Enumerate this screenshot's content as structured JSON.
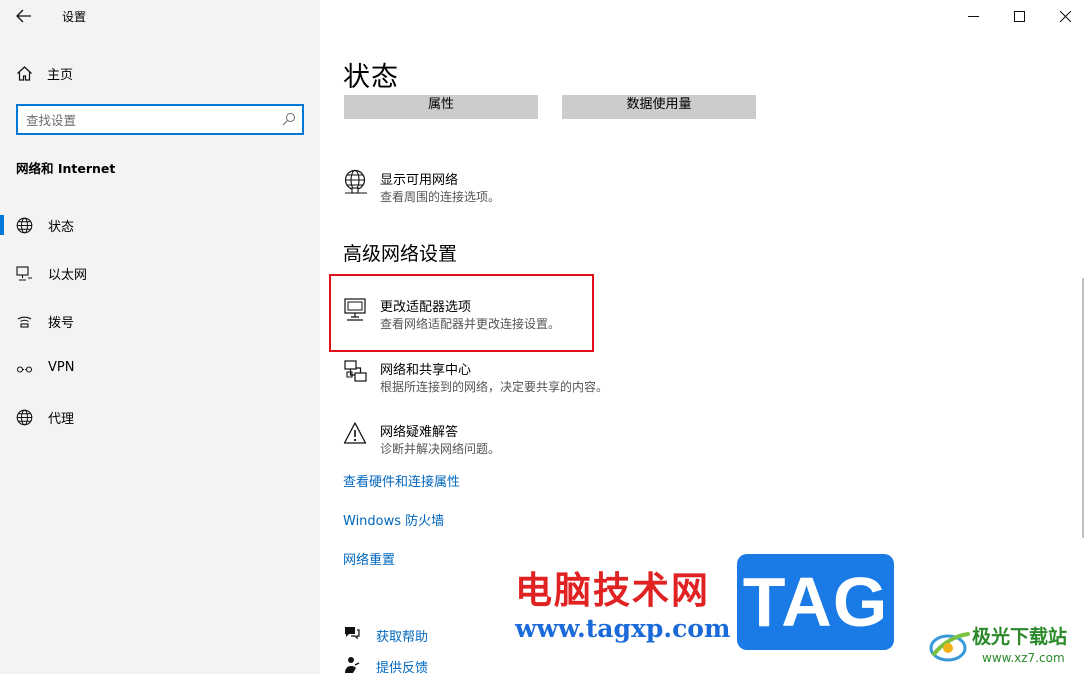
{
  "app": {
    "title": "设置"
  },
  "sidebar": {
    "home_label": "主页",
    "search_placeholder": "查找设置",
    "section_title": "网络和 Internet",
    "items": [
      {
        "label": "状态",
        "icon": "globe-icon",
        "active": true
      },
      {
        "label": "以太网",
        "icon": "monitor-network-icon",
        "active": false
      },
      {
        "label": "拨号",
        "icon": "dialup-icon",
        "active": false
      },
      {
        "label": "VPN",
        "icon": "vpn-icon",
        "active": false
      },
      {
        "label": "代理",
        "icon": "globe-icon",
        "active": false
      }
    ]
  },
  "main": {
    "title": "状态",
    "buttons": {
      "properties": "属性",
      "data_usage": "数据使用量"
    },
    "show_networks": {
      "title": "显示可用网络",
      "desc": "查看周围的连接选项。"
    },
    "advanced_heading": "高级网络设置",
    "adapter": {
      "title": "更改适配器选项",
      "desc": "查看网络适配器并更改连接设置。"
    },
    "sharing": {
      "title": "网络和共享中心",
      "desc": "根据所连接到的网络，决定要共享的内容。"
    },
    "troubleshoot": {
      "title": "网络疑难解答",
      "desc": "诊断并解决网络问题。"
    },
    "links": {
      "hardware": "查看硬件和连接属性",
      "firewall": "Windows 防火墙",
      "reset": "网络重置"
    },
    "help": {
      "get_help": "获取帮助",
      "feedback": "提供反馈"
    }
  },
  "watermark": {
    "site_cn": "电脑技术网",
    "site_url": "www.tagxp.com",
    "tag": "TAG",
    "logo_cn": "极光下载站",
    "logo_url": "www.xz7.com"
  },
  "colors": {
    "accent": "#0078d7",
    "link": "#0067c0",
    "highlight_box": "#e0101b",
    "sidebar_bg": "#f3f3f3"
  }
}
